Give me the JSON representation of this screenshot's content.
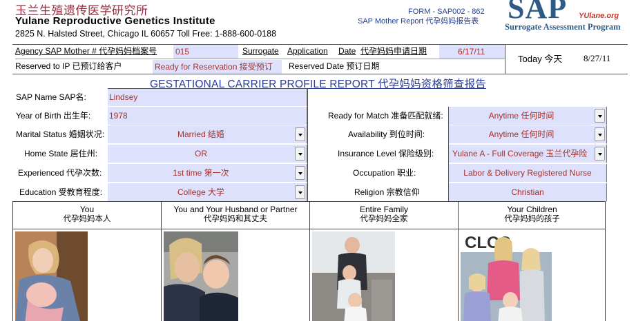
{
  "header": {
    "cn_title": "玉兰生殖遗传医学研究所",
    "en_title": "Yulane Reproductive Genetics Institute",
    "address": "2825 N. Halsted Street, Chicago IL 60657  Toll Free: 1-888-600-0188",
    "form_code": "FORM - SAP002 - 862",
    "form_subtitle": "SAP Mother Report 代孕妈妈报告表",
    "logo_text": "SAP",
    "logo_brand": "YUlane.org",
    "logo_subtitle": "Surrogate Assessment Program"
  },
  "agency": {
    "agency_label": "Agency SAP Mother # 代孕妈妈档案号",
    "agency_value": "015",
    "surrogate_word": "Surrogate",
    "application_word": "Application",
    "date_word": "Date",
    "application_date_cn": "代孕妈妈申请日期",
    "application_date_value": "6/17/11",
    "today_label": "Today 今天",
    "today_value": "8/27/11",
    "reserved_ip_label": "Reserved to IP  已预订给客户",
    "reserved_ip_value": "Ready for Reservation 接受预订",
    "reserved_date_label": "Reserved Date 预订日期",
    "reserved_date_value": ""
  },
  "report_title": "GESTATIONAL CARRIER PROFILE REPORT 代孕妈妈资格筛查报告",
  "profile_left": [
    {
      "label": "SAP Name SAP名:",
      "value": "Lindsey",
      "dropdown": false
    },
    {
      "label": "Year of Birth 出生年:",
      "value": "1978",
      "dropdown": false
    },
    {
      "label": "Marital Status 婚姻状况:",
      "value": "Married 结婚",
      "dropdown": true
    },
    {
      "label": "Home State 居住州:",
      "value": "OR",
      "dropdown": true
    },
    {
      "label": "Experienced  代孕次数:",
      "value": "1st time  第一次",
      "dropdown": true
    },
    {
      "label": "Education 受教育程度:",
      "value": "College 大学",
      "dropdown": true
    }
  ],
  "profile_right": [
    {
      "label": "Ready for Match 准备匹配就绪:",
      "value": "Anytime 任何时间",
      "dropdown": true
    },
    {
      "label": "Availability 到位时间:",
      "value": "Anytime 任何时间",
      "dropdown": true
    },
    {
      "label": "Insurance Level 保险级别:",
      "value": "Yulane A - Full Coverage 玉兰代孕险",
      "dropdown": true
    },
    {
      "label": "Occupation  职业:",
      "value": "Labor & Delivery Registered Nurse",
      "dropdown": false
    },
    {
      "label": "Religion 宗教信仰",
      "value": "Christian",
      "dropdown": false
    }
  ],
  "photos": [
    {
      "title_en": "You",
      "title_cn": "代孕妈妈本人"
    },
    {
      "title_en": "You and Your Husband or Partner",
      "title_cn": "代孕妈妈和其丈夫"
    },
    {
      "title_en": "Entire Family",
      "title_cn": "代孕妈妈全家"
    },
    {
      "title_en": "Your Children",
      "title_cn": "代孕妈妈的孩子"
    }
  ],
  "photo_sign_text": "CLOS",
  "colors": {
    "field_fill": "#dde1fb",
    "value_text": "#a8302a",
    "title_blue": "#2a3d9a",
    "logo_blue": "#2e5a86",
    "cn_title_red": "#9b2b3f"
  }
}
